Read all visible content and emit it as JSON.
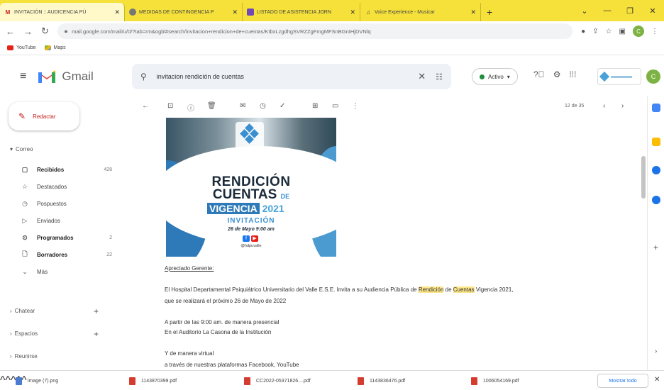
{
  "browser": {
    "tabs": [
      {
        "label": "INVITACIÓN :: AUDICENCIA PÚ",
        "active": true
      },
      {
        "label": "MEDIDAS DE CONTINGENCIA P"
      },
      {
        "label": "LISTADO DE ASISTENCIA JORN"
      },
      {
        "label": "Voice Experience - Musicar"
      }
    ],
    "new_tab": "+",
    "url": "mail.google.com/mail/u/0/?tab=rm&ogbl#search/invitacion+rendicion+de+cuentas/KtbxLzgdhgSVRZZgFmgMFSnBGnIHjDVNlq",
    "bookmarks": [
      "YouTube",
      "Maps"
    ]
  },
  "gmail": {
    "logo_text": "Gmail",
    "search_query": "invitacion rendición de cuentas",
    "status": "Activo",
    "avatar_letter": "C",
    "compose_label": "Redactar",
    "sections": {
      "mail": "Correo",
      "chat": "Chatear",
      "spaces": "Espacios",
      "meet": "Reunirse"
    },
    "nav": [
      {
        "label": "Recibidos",
        "count": "428",
        "bold": true
      },
      {
        "label": "Destacados",
        "count": ""
      },
      {
        "label": "Pospuestos",
        "count": ""
      },
      {
        "label": "Enviados",
        "count": ""
      },
      {
        "label": "Programados",
        "count": "2",
        "bold": true
      },
      {
        "label": "Borradores",
        "count": "22",
        "bold": true
      },
      {
        "label": "Más",
        "count": ""
      }
    ],
    "pager": "12 de 35"
  },
  "email": {
    "image": {
      "title_line1": "RENDICIÓN",
      "title_line2": "CUENTAS",
      "title_de": "DE",
      "vigencia": "VIGENCIA",
      "year": "2021",
      "invitation": "INVITACIÓN",
      "date_time": "26 de Mayo 9:00 am",
      "handle": "@hdpuvalle"
    },
    "greeting": "Apreciado Gerente:",
    "para1_pre": "El Hospital Departamental Psiquiátrico Universitario del Valle E.S.E. Invita a su Audiencia Pública de ",
    "para1_hl1": "Rendición",
    "para1_mid": " de ",
    "para1_hl2": "Cuentas",
    "para1_post": " Vigencia 2021,",
    "para1_line2": "que se realizará el próximo 26 de Mayo de 2022",
    "para2_line1": "A partir de las 9:00 am. de manera presencial",
    "para2_line2": "En el Auditorio La Casona de la Institución",
    "para3_line1": "Y de manera virtual",
    "para3_line2": "a través de nuestras plataformas Facebook, YouTube"
  },
  "downloads": {
    "items": [
      "image (7).png",
      "1143870399.pdf",
      "CC2022-05371826....pdf",
      "1143836476.pdf",
      "1006054169.pdf"
    ],
    "show_all": "Mostrar todo"
  }
}
